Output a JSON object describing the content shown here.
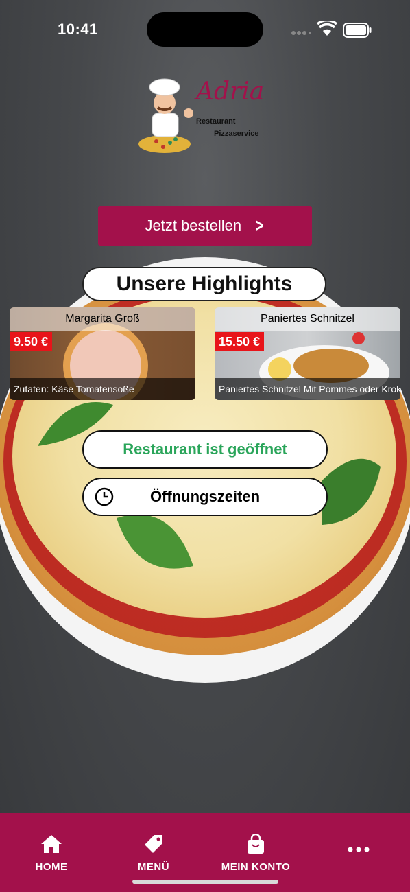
{
  "status_bar": {
    "time": "10:41"
  },
  "brand": {
    "name": "Adria",
    "line1": "Restaurant",
    "line2": "Pizzaservice"
  },
  "cta": {
    "label": "Jetzt bestellen"
  },
  "highlights": {
    "title": "Unsere Highlights",
    "items": [
      {
        "name": "Margarita Groß",
        "price": "9.50 €",
        "description": "Zutaten: Käse Tomatensoße"
      },
      {
        "name": "Paniertes Schnitzel",
        "price": "15.50 €",
        "description": "Paniertes Schnitzel Mit Pommes oder Krok..."
      }
    ]
  },
  "restaurant_status": {
    "label": "Restaurant ist geöffnet",
    "color": "#2aa55a"
  },
  "opening_hours": {
    "label": "Öffnungszeiten"
  },
  "bottom_nav": {
    "items": [
      {
        "label": "HOME",
        "icon": "home-icon"
      },
      {
        "label": "MENÜ",
        "icon": "tag-icon"
      },
      {
        "label": "MEIN KONTO",
        "icon": "shopping-bag-icon"
      },
      {
        "label": "",
        "icon": "more-icon"
      }
    ]
  },
  "colors": {
    "brand": "#a3114b",
    "price_tag": "#e8141a"
  }
}
